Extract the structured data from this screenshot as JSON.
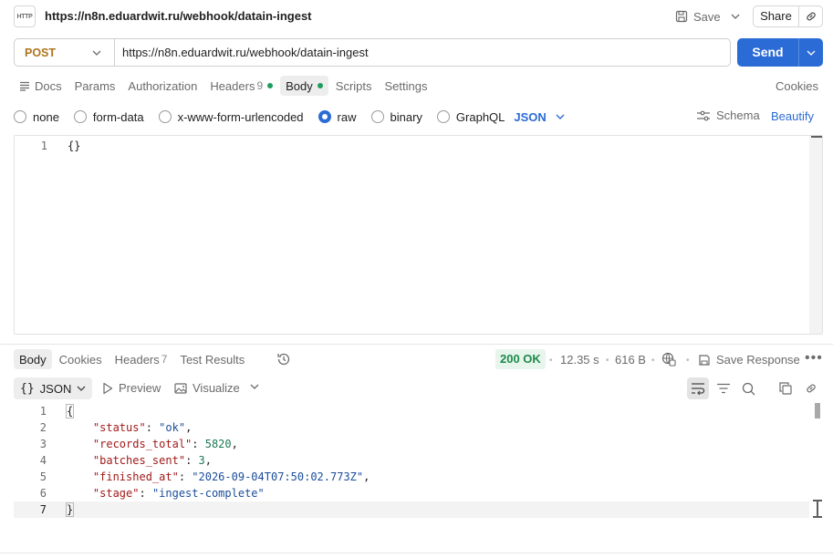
{
  "header": {
    "icon_label": "HTTP",
    "title": "https://n8n.eduardwit.ru/webhook/datain-ingest",
    "save_label": "Save",
    "share_label": "Share"
  },
  "request": {
    "method": "POST",
    "url": "https://n8n.eduardwit.ru/webhook/datain-ingest",
    "send_label": "Send",
    "tabs": [
      {
        "label": "Docs"
      },
      {
        "label": "Params"
      },
      {
        "label": "Authorization"
      },
      {
        "label": "Headers",
        "count": "9"
      },
      {
        "label": "Body"
      },
      {
        "label": "Scripts"
      },
      {
        "label": "Settings"
      }
    ],
    "cookies_label": "Cookies",
    "body_types": [
      "none",
      "form-data",
      "x-www-form-urlencoded",
      "raw",
      "binary",
      "GraphQL"
    ],
    "selected_body_type": "raw",
    "format": "JSON",
    "schema_label": "Schema",
    "beautify_label": "Beautify",
    "editor_lines": [
      {
        "num": "1",
        "code": "{}"
      }
    ]
  },
  "response": {
    "tabs": [
      {
        "label": "Body"
      },
      {
        "label": "Cookies"
      },
      {
        "label": "Headers",
        "count": "7"
      },
      {
        "label": "Test Results"
      }
    ],
    "status": "200 OK",
    "time": "12.35 s",
    "size": "616 B",
    "save_response_label": "Save Response",
    "format": "JSON",
    "preview_label": "Preview",
    "visualize_label": "Visualize",
    "line_numbers": [
      "1",
      "2",
      "3",
      "4",
      "5",
      "6",
      "7"
    ],
    "body": {
      "open": "{",
      "close": "}",
      "status_key": "\"status\"",
      "status_val": "\"ok\"",
      "records_key": "\"records_total\"",
      "records_val": "5820",
      "batches_key": "\"batches_sent\"",
      "batches_val": "3",
      "finished_key": "\"finished_at\"",
      "finished_val": "\"2026-09-04T07:50:02.773Z\"",
      "stage_key": "\"stage\"",
      "stage_val": "\"ingest-complete\""
    }
  },
  "colors": {
    "accent": "#2b6bd6",
    "method_post": "#b0741c",
    "status_ok": "#1e8a4c",
    "json_key": "#a11a1a",
    "json_string": "#1a4d9a",
    "json_number": "#1e7a55"
  },
  "icons": {
    "title": "http-request-icon",
    "save": "floppy-disk-icon",
    "share_link": "link-icon",
    "docs": "docs-lines-icon",
    "schema": "schema-icon",
    "history": "history-icon",
    "network": "network-globe-icon",
    "save_response": "save-response-icon",
    "more": "more-horizontal-icon",
    "preview": "play-icon",
    "visualize": "image-icon",
    "wrap": "wrap-lines-icon",
    "filter": "filter-icon",
    "search": "search-icon",
    "copy": "copy-icon",
    "link": "link-icon"
  }
}
